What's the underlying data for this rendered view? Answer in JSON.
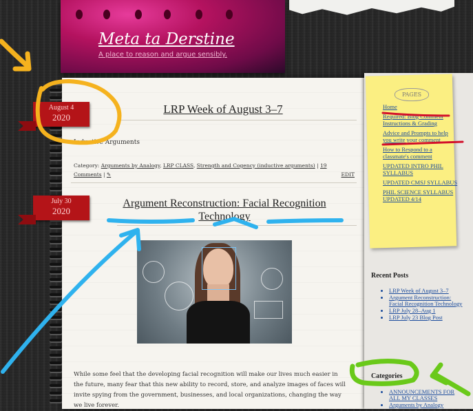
{
  "site": {
    "title": "Meta ta Derstine",
    "tagline": "A place to reason and argue sensibly."
  },
  "posts": [
    {
      "date_month": "August 4",
      "date_year": "2020",
      "title": "LRP Week of August 3–7",
      "excerpt": "Inductive Arguments",
      "meta_prefix": "Category: ",
      "categories": [
        "Arguments by Analogy",
        "LRP CLASS",
        "Strength and Cogency (inductive arguments)"
      ],
      "comments": "19 Comments",
      "edit": "EDIT"
    },
    {
      "date_month": "July 30",
      "date_year": "2020",
      "title_line1": "Argument Reconstruction: Facial Recognition",
      "title_line2": "Technology",
      "body": "While some feel that the developing facial recognition will make our lives much easier in the future, many fear that this new ability to record, store, and analyze images of faces will invite spying from the government, businesses, and local organizations, changing the way we live forever."
    }
  ],
  "sidebar": {
    "pages_header": "PAGES",
    "pages": [
      "Home",
      "Required: Blog Comment Instructions & Grading",
      "Advice and Prompts to help you write your comment",
      "How to Respond to a classmate's comment",
      "UPDATED INTRO PHIL SYLLABUS",
      "UPDATED CMSJ SYLLABUS",
      "PHIL SCIENCE SYLLABUS UPDATED 4/14"
    ],
    "recent_posts_title": "Recent Posts",
    "recent_posts": [
      "LRP Week of August 3–7",
      "Argument Reconstruction: Facial Recognition Technology",
      "LRP July 28–Aug 1",
      "LRP July 23 Blog Post"
    ],
    "categories_title": "Categories",
    "categories": [
      "ANNOUNCEMENTS FOR ALL MY CLASSES",
      "Arguments by Analogy"
    ]
  },
  "annotations": {
    "orange": "#f5b21e",
    "red": "#d2102a",
    "blue": "#2fb2ee",
    "green": "#6ac91a"
  }
}
